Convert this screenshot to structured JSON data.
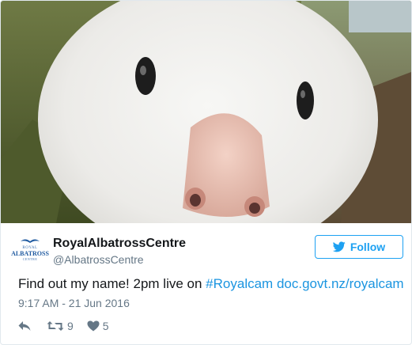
{
  "account": {
    "display_name": "RoyalAlbatrossCentre",
    "handle": "@AlbatrossCentre",
    "avatar_logo": {
      "line1": "ROYAL",
      "line2": "ALBATROSS",
      "line3": "CENTRE"
    }
  },
  "follow_button": {
    "label": "Follow",
    "icon": "twitter-bird-icon"
  },
  "tweet": {
    "text_prefix": "Find out my name! 2pm live on ",
    "hashtag": "#Royalcam",
    "link": "doc.govt.nz/royalcam",
    "timestamp": "9:17 AM - 21 Jun 2016"
  },
  "actions": {
    "reply_icon": "reply-icon",
    "retweet_icon": "retweet-icon",
    "retweet_count": "9",
    "like_icon": "heart-icon",
    "like_count": "5"
  },
  "colors": {
    "accent": "#1da1f2",
    "link": "#1b95e0",
    "text": "#14171a",
    "secondary": "#657786",
    "border": "#e1e8ed"
  }
}
